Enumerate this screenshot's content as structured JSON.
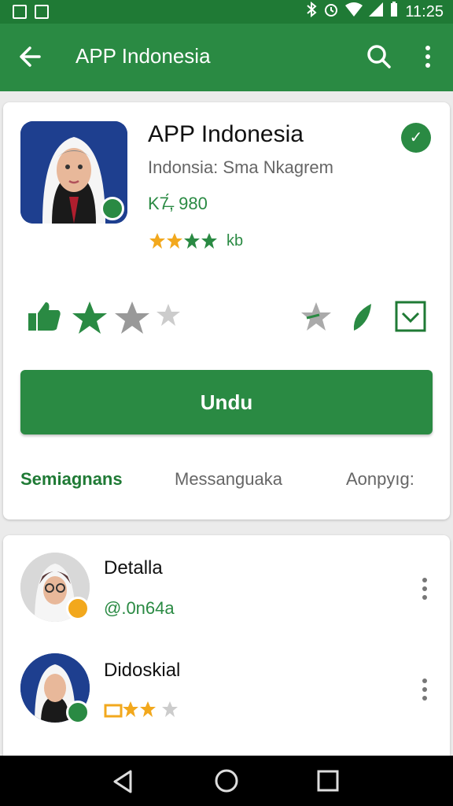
{
  "status_bar": {
    "time": "11:25"
  },
  "app_bar": {
    "title": "APP Indonesia"
  },
  "app": {
    "name": "APP Indonesia",
    "subtitle": "Indonsia: Sma Nkagrem",
    "count": "K7̶́, 980",
    "rating_text": "kb",
    "install_label": "Undu"
  },
  "tabs": [
    {
      "label": "Semiagnans"
    },
    {
      "label": "Messanguaka"
    },
    {
      "label": "Aonpyıg:"
    }
  ],
  "list": [
    {
      "title": "Detalla",
      "subtitle": "@.0n64a"
    },
    {
      "title": "Didoskial",
      "subtitle": ""
    }
  ],
  "colors": {
    "primary": "#2a8a43",
    "primary_dark": "#1f7a35",
    "accent_star": "#f2a81d"
  }
}
